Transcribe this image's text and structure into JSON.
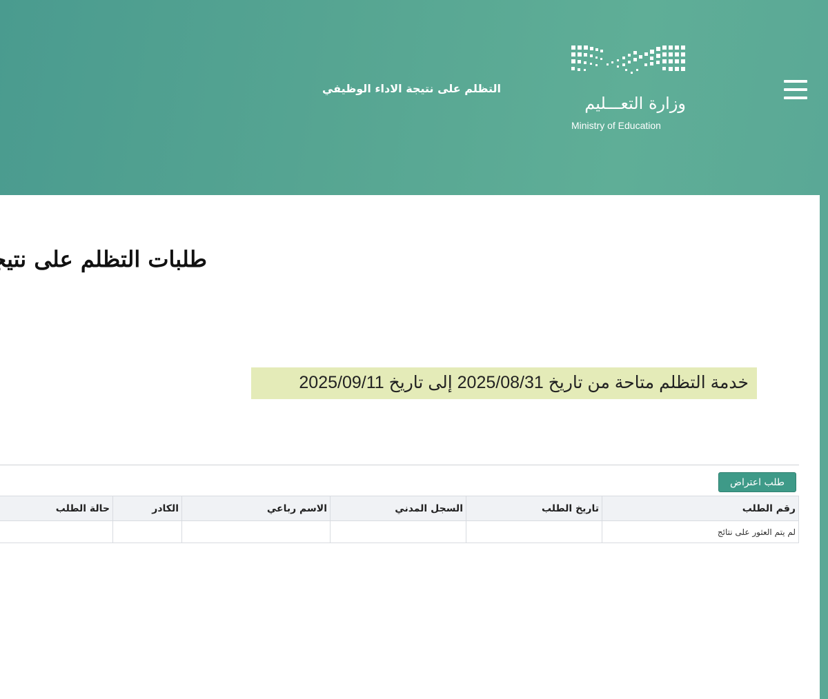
{
  "header": {
    "title": "التظلم على نتيجة الاداء الوظيفي",
    "logo_ar": "وزارة التعـــليم",
    "logo_en": "Ministry of Education",
    "menu_icon": "hamburger-icon",
    "background": "#56a592"
  },
  "page": {
    "title": "طلبات التظلم على نتيجة الاداء الوظيفي",
    "notice": "خدمة التظلم متاحة من تاريخ 2025/08/31 إلى تاريخ 2025/09/11"
  },
  "toolbar": {
    "objection_label": "طلب اعتراض"
  },
  "table": {
    "columns": [
      "رقم الطلب",
      "تاريخ الطلب",
      "السجل المدني",
      "الاسم رباعي",
      "الكادر",
      "حالة الطلب"
    ],
    "empty_message": "لم يتم العثور على نتائج"
  },
  "colors": {
    "accent": "#3e9a88",
    "notice_bg": "#e4ebb8"
  }
}
